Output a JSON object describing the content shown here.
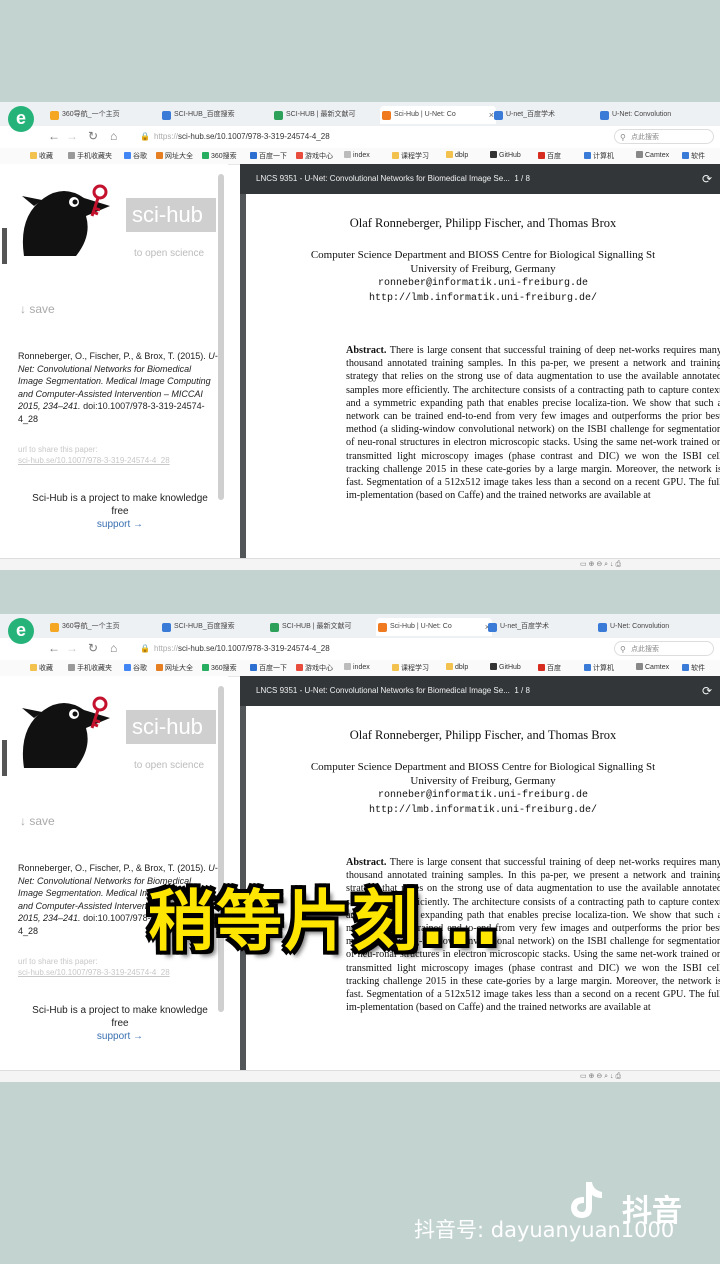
{
  "browser": {
    "logo": "e",
    "tabs": [
      {
        "label": "360导航_一个主页",
        "color": "#f5a623"
      },
      {
        "label": "SCI-HUB_百度搜索",
        "color": "#3b7bd8"
      },
      {
        "label": "SCI-HUB | 最新文献可",
        "color": "#2da15a"
      },
      {
        "label": "Sci-Hub | U-Net: Co",
        "color": "#f07a20",
        "active": true
      },
      {
        "label": "U-net_百度学术",
        "color": "#3b7bd8"
      },
      {
        "label": "U-Net: Convolution",
        "color": "#3b7bd8"
      }
    ],
    "url": "sci-hub.se/10.1007/978-3-319-24574-4_28",
    "url_prefix": "https://",
    "search_placeholder": "点此搜索",
    "bookmarks": [
      "收藏",
      "手机收藏夹",
      "谷歌",
      "网址大全",
      "360搜索",
      "百度一下",
      "游戏中心",
      "index",
      "课程学习",
      "dblp",
      "GitHub",
      "百度",
      "计算机",
      "Camtex",
      "软件"
    ]
  },
  "scihub": {
    "brand": "sci-hub",
    "tagline": "to open science",
    "save_label": "↓ save",
    "citation_plain": "Ronneberger, O., Fischer, P., & Brox, T. (2015).",
    "citation_title": "U-Net: Convolutional Networks for Biomedical Image Segmentation. Medical Image Computing and Computer-Assisted Intervention – MICCAI 2015, 234–241.",
    "citation_doi": "doi:10.1007/978-3-319-24574-4_28",
    "share_label": "url to share this paper:",
    "share_link": "sci-hub.se/10.1007/978-3-319-24574-4_28",
    "mission": "Sci-Hub is a project to make knowledge free",
    "support": "support →"
  },
  "pdf": {
    "title": "LNCS 9351 - U-Net: Convolutional Networks for Biomedical Image Se...",
    "page_indicator": "1 / 8",
    "authors": "Olaf Ronneberger, Philipp Fischer, and Thomas Brox",
    "affil_1": "Computer Science Department and BIOSS Centre for Biological Signalling St",
    "affil_2": "University of Freiburg, Germany",
    "email": "ronneber@informatik.uni-freiburg.de",
    "web": "http://lmb.informatik.uni-freiburg.de/",
    "abstract_label": "Abstract.",
    "abstract_text": "There is large consent that successful training of deep net-works requires many thousand annotated training samples. In this pa-per, we present a network and training strategy that relies on the strong use of data augmentation to use the available annotated samples more efficiently. The architecture consists of a contracting path to capture context and a symmetric expanding path that enables precise localiza-tion. We show that such a network can be trained end-to-end from very few images and outperforms the prior best method (a sliding-window convolutional network) on the ISBI challenge for segmentation of neu-ronal structures in electron microscopic stacks. Using the same net-work trained on transmitted light microscopy images (phase contrast and DIC) we won the ISBI cell tracking challenge 2015 in these cate-gories by a large margin. Moreover, the network is fast. Segmentation of a 512x512 image takes less than a second on a recent GPU. The full im-plementation (based on Caffe) and the trained networks are available at"
  },
  "overlay_text": "稍等片刻...",
  "tiktok": {
    "app_name": "抖音",
    "account": "抖音号: dayuanyuan1000"
  }
}
